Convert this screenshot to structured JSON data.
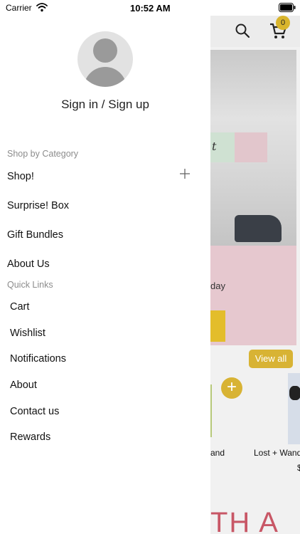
{
  "status_bar": {
    "carrier": "Carrier",
    "time": "10:52 AM"
  },
  "background_app": {
    "cart_count": "0",
    "hero_script_text": "t",
    "hero_caption": "day",
    "view_all_label": "View all",
    "product_left_label": "and",
    "product_right_label": "Lost + Wand",
    "product_price_fragment": "$",
    "banner_text": "TH A",
    "accent_color": "#d8b334",
    "pink_color": "#e6c8cf"
  },
  "drawer": {
    "sign_in_label": "Sign in / Sign up",
    "shop_by_category": {
      "header": "Shop by Category",
      "items": [
        "Shop!",
        "Surprise! Box",
        "Gift Bundles",
        "About Us"
      ]
    },
    "quick_links": {
      "header": "Quick Links",
      "items": [
        "Cart",
        "Wishlist",
        "Notifications",
        "About",
        "Contact us",
        "Rewards"
      ]
    }
  }
}
